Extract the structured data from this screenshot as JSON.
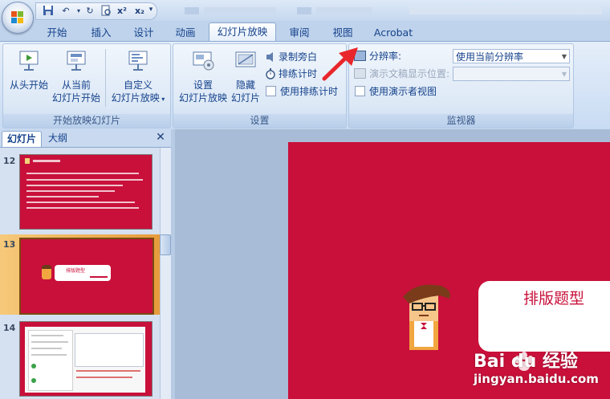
{
  "qat": {
    "superscript": "x²",
    "subscript": "x₂"
  },
  "tabs": [
    {
      "label": "开始"
    },
    {
      "label": "插入"
    },
    {
      "label": "设计"
    },
    {
      "label": "动画"
    },
    {
      "label": "幻灯片放映",
      "active": true
    },
    {
      "label": "审阅"
    },
    {
      "label": "视图"
    },
    {
      "label": "Acrobat"
    }
  ],
  "groups": {
    "start_show": {
      "label": "开始放映幻灯片",
      "from_beginning": "从头开始",
      "from_current_1": "从当前",
      "from_current_2": "幻灯片开始",
      "custom_1": "自定义",
      "custom_2": "幻灯片放映"
    },
    "setup": {
      "label": "设置",
      "setup_show_1": "设置",
      "setup_show_2": "幻灯片放映",
      "hide_1": "隐藏",
      "hide_2": "幻灯片",
      "record_narration": "录制旁白",
      "rehearse_timings": "排练计时",
      "use_rehearsed": "使用排练计时"
    },
    "monitors": {
      "label": "监视器",
      "resolution_label": "分辨率:",
      "resolution_value": "使用当前分辨率",
      "show_on_label": "演示文稿显示位置:",
      "show_on_value": "",
      "presenter_view": "使用演示者视图"
    }
  },
  "pane": {
    "tab_slides": "幻灯片",
    "tab_outline": "大纲",
    "close_glyph": "✕",
    "slides": [
      {
        "num": "12"
      },
      {
        "num": "13",
        "selected": true,
        "thumb_title": "排版题型"
      },
      {
        "num": "14"
      }
    ]
  },
  "slide": {
    "bubble_text": "排版题型"
  },
  "watermark": {
    "logo": "Bai du 经验",
    "url": "jingyan.baidu.com"
  },
  "colors": {
    "slide_red": "#c8103a",
    "ribbon_text": "#15428b",
    "arrow_red": "#e8262b"
  }
}
